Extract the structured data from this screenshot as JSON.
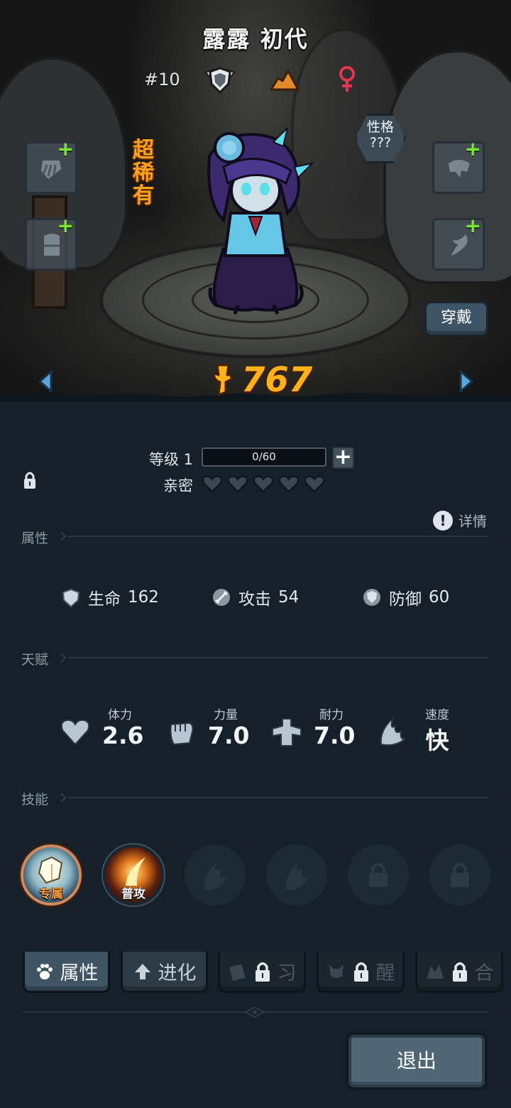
{
  "hero": {
    "name": "露露 初代",
    "rank": "#10",
    "rarity": "超稀有",
    "personality": "性格\n???",
    "wear_button": "穿戴",
    "power": "767",
    "icons": {
      "badge": "shield-wings-icon",
      "terrain": "mountain-icon",
      "gender": "female-icon",
      "prev": "arrow-left-icon",
      "next": "arrow-right-icon",
      "power": "trophy-icon"
    },
    "colors": {
      "rarity": "#ffa21a",
      "power": "#ffb21a",
      "gender": "#e8344e",
      "plus": "#7be835"
    }
  },
  "level": {
    "label": "等级 1",
    "xp": "0/60",
    "xp_fraction": 0,
    "intimacy_label": "亲密",
    "hearts_filled": 0,
    "hearts_total": 5
  },
  "sections": {
    "attributes": "属性",
    "talent": "天赋",
    "skills": "技能",
    "detail": "详情"
  },
  "attributes": [
    {
      "icon": "heart-shield-icon",
      "label": "生命",
      "value": "162"
    },
    {
      "icon": "sword-icon",
      "label": "攻击",
      "value": "54"
    },
    {
      "icon": "shield-icon",
      "label": "防御",
      "value": "60"
    }
  ],
  "talents": [
    {
      "icon": "heart-icon",
      "label": "体力",
      "value": "2.6"
    },
    {
      "icon": "fist-icon",
      "label": "力量",
      "value": "7.0"
    },
    {
      "icon": "muscle-icon",
      "label": "耐力",
      "value": "7.0"
    },
    {
      "icon": "wing-icon",
      "label": "速度",
      "value": "快"
    }
  ],
  "skills": [
    {
      "label": "专属",
      "state": "unlocked"
    },
    {
      "label": "普攻",
      "state": "unlocked"
    },
    {
      "label": "",
      "state": "empty"
    },
    {
      "label": "",
      "state": "empty"
    },
    {
      "label": "",
      "state": "locked"
    },
    {
      "label": "",
      "state": "locked"
    }
  ],
  "tabs": [
    {
      "label": "属性",
      "state": "active",
      "icon": "paw-icon"
    },
    {
      "label": "进化",
      "state": "normal",
      "icon": "up-arrow-icon"
    },
    {
      "label": "习",
      "state": "locked",
      "icon": "book-icon"
    },
    {
      "label": "醒",
      "state": "locked",
      "icon": "demon-icon"
    },
    {
      "label": "合",
      "state": "locked",
      "icon": "fusion-icon"
    }
  ],
  "exit_button": "退出"
}
